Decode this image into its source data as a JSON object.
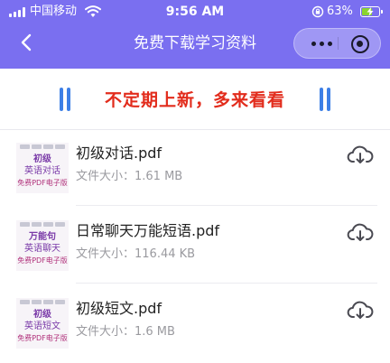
{
  "status_bar": {
    "carrier": "中国移动",
    "time": "9:56 AM",
    "battery_percent": "63%",
    "battery_level": 0.63,
    "icons": [
      "signal-icon",
      "wifi-icon",
      "orientation-lock-icon",
      "battery-charging-icon"
    ]
  },
  "header": {
    "title": "免费下载学习资料",
    "back_icon": "chevron-left-icon",
    "more_icon": "more-dots-icon",
    "close_icon": "target-close-icon"
  },
  "banner": {
    "text": "不定期上新，多来看看"
  },
  "files": [
    {
      "name": "初级对话.pdf",
      "size": "文件大小：1.61 MB",
      "thumb": {
        "line1": "初级",
        "line2": "英语对话",
        "line3": "免费PDF电子版"
      }
    },
    {
      "name": "日常聊天万能短语.pdf",
      "size": "文件大小：116.44 KB",
      "thumb": {
        "line1": "万能句",
        "line2": "英语聊天",
        "line3": "免费PDF电子版"
      }
    },
    {
      "name": "初级短文.pdf",
      "size": "文件大小：1.6 MB",
      "thumb": {
        "line1": "初级",
        "line2": "英语短文",
        "line3": "免费PDF电子版"
      }
    }
  ],
  "colors": {
    "header_bg": "#7a6ff0",
    "banner_text": "#e22c1c",
    "banner_bars": "#3d7fe6",
    "thumb_text": "#7a3aa8"
  }
}
